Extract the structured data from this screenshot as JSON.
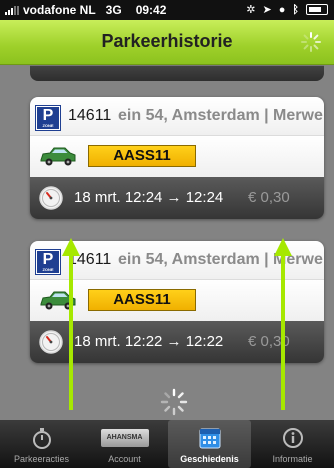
{
  "status": {
    "carrier": "vodafone NL",
    "network": "3G",
    "time": "09:42"
  },
  "header": {
    "title": "Parkeerhistorie"
  },
  "records": [
    {
      "zone_code": "14611",
      "location": "ein 54, Amsterdam | Merwe",
      "plate": "AASS11",
      "time_range": "18 mrt. 12:24 → 12:24",
      "price": "€ 0,30"
    },
    {
      "zone_code": "14611",
      "location": "ein 54, Amsterdam | Merwe",
      "plate": "AASS11",
      "time_range": "18 mrt. 12:22 → 12:22",
      "price": "€ 0,30"
    }
  ],
  "tabs": [
    {
      "label": "Parkeeracties",
      "icon": "stopwatch-icon",
      "selected": false
    },
    {
      "label": "Account",
      "icon": "account-card-icon",
      "selected": false,
      "icon_text": "AHANSMA"
    },
    {
      "label": "Geschiedenis",
      "icon": "calendar-icon",
      "selected": true
    },
    {
      "label": "Informatie",
      "icon": "info-icon",
      "selected": false
    }
  ],
  "colors": {
    "header_green": "#9ed02a",
    "plate_yellow": "#f7c30b",
    "parking_blue": "#1f3f91",
    "annotation_arrow": "#a6e800"
  }
}
